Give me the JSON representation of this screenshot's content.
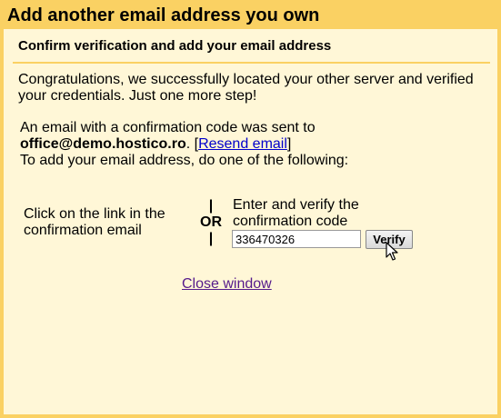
{
  "dialog": {
    "title": "Add another email address you own",
    "subtitle": "Confirm verification and add your email address",
    "congrats_line1": "Congratulations, we successfully located your other server and verified",
    "congrats_line2": "your credentials. Just one more step!",
    "sent_line": "An email with a confirmation code was sent to",
    "email": "office@demo.hostico.ro",
    "email_suffix": ". [",
    "resend_label": "Resend email",
    "resend_close": "]",
    "instruction": "To add your email address, do one of the following:",
    "option_link_line1": "Click on the link in the",
    "option_link_line2": "confirmation email",
    "or_bar_top": "|",
    "or_label": "OR",
    "or_bar_bottom": "|",
    "option_code_line1": "Enter and verify the",
    "option_code_line2": "confirmation code",
    "code_value": "336470326",
    "verify_label": "Verify",
    "close_label": "Close window"
  },
  "colors": {
    "header_bg": "#fad163",
    "panel_bg": "#fff7d7",
    "link": "#0000cc",
    "visited_link": "#551a8b"
  },
  "icons": {
    "cursor": "arrow-cursor"
  }
}
